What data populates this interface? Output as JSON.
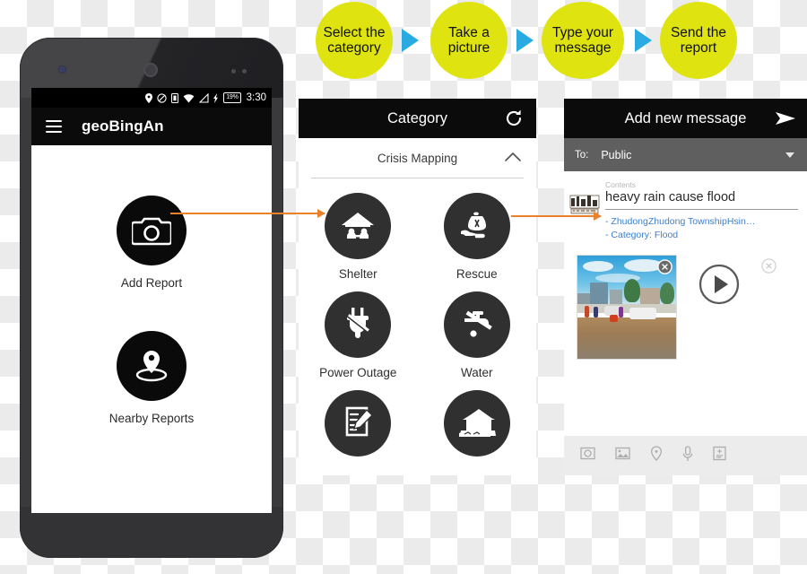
{
  "steps": {
    "items": [
      {
        "label": "Select the category"
      },
      {
        "label": "Take a picture"
      },
      {
        "label": "Type your message"
      },
      {
        "label": "Send the report"
      }
    ],
    "circle_color": "#dfe310",
    "arrow_color": "#29abe2",
    "arrow_icon": "play-triangle-icon"
  },
  "phone": {
    "statusbar": {
      "icons": [
        "location-pin-icon",
        "do-not-disturb-icon",
        "sim-card-icon",
        "wifi-icon",
        "signal-bars-icon",
        "charging-bolt-icon"
      ],
      "battery_percent": "19%",
      "clock": "3:30"
    },
    "appbar": {
      "menu_icon": "hamburger-menu-icon",
      "title": "geoBingAn"
    },
    "home": {
      "tiles": [
        {
          "label": "Add Report",
          "icon": "camera-icon"
        },
        {
          "label": "Nearby Reports",
          "icon": "map-pin-radar-icon"
        }
      ]
    },
    "navbar": {
      "back": "back-triangle-icon",
      "home": "home-icon",
      "recents": "square-recents-icon"
    }
  },
  "category": {
    "header": {
      "title": "Category",
      "refresh_icon": "refresh-icon"
    },
    "section": {
      "label": "Crisis Mapping",
      "collapse_icon": "chevron-up-icon"
    },
    "items": [
      {
        "label": "Shelter",
        "icon": "shelter-house-people-icon"
      },
      {
        "label": "Rescue",
        "icon": "rescue-hand-aid-icon"
      },
      {
        "label": "Power Outage",
        "icon": "power-plug-icon"
      },
      {
        "label": "Water",
        "icon": "faucet-icon"
      },
      {
        "label": "",
        "icon": "report-form-pen-icon"
      },
      {
        "label": "",
        "icon": "damaged-house-icon"
      }
    ]
  },
  "message": {
    "header": {
      "title": "Add new message",
      "send_icon": "send-paper-plane-icon"
    },
    "to_row": {
      "label": "To:",
      "value": "Public",
      "caret_icon": "chevron-down-icon"
    },
    "contents": {
      "label": "Contents",
      "value": "heavy rain cause flood",
      "thumbnail_icon": "sketch-thumbnail-icon"
    },
    "meta": [
      "-  ZhudongZhudong TownshipHsin…",
      "-  Category:  Flood"
    ],
    "media": {
      "photo_alt": "flooded-street-photo",
      "photo_close_icon": "close-x-circle-icon",
      "audio_play_icon": "play-circle-icon",
      "audio_close_icon": "close-x-circle-icon"
    },
    "toolbar": {
      "icons": [
        "camera-icon",
        "gallery-image-icon",
        "location-pin-icon",
        "microphone-icon",
        "form-add-icon"
      ]
    }
  },
  "connectors": {
    "color": "#e8822c",
    "arrows": [
      "add-report-to-category-arrow",
      "category-to-message-arrow"
    ]
  }
}
